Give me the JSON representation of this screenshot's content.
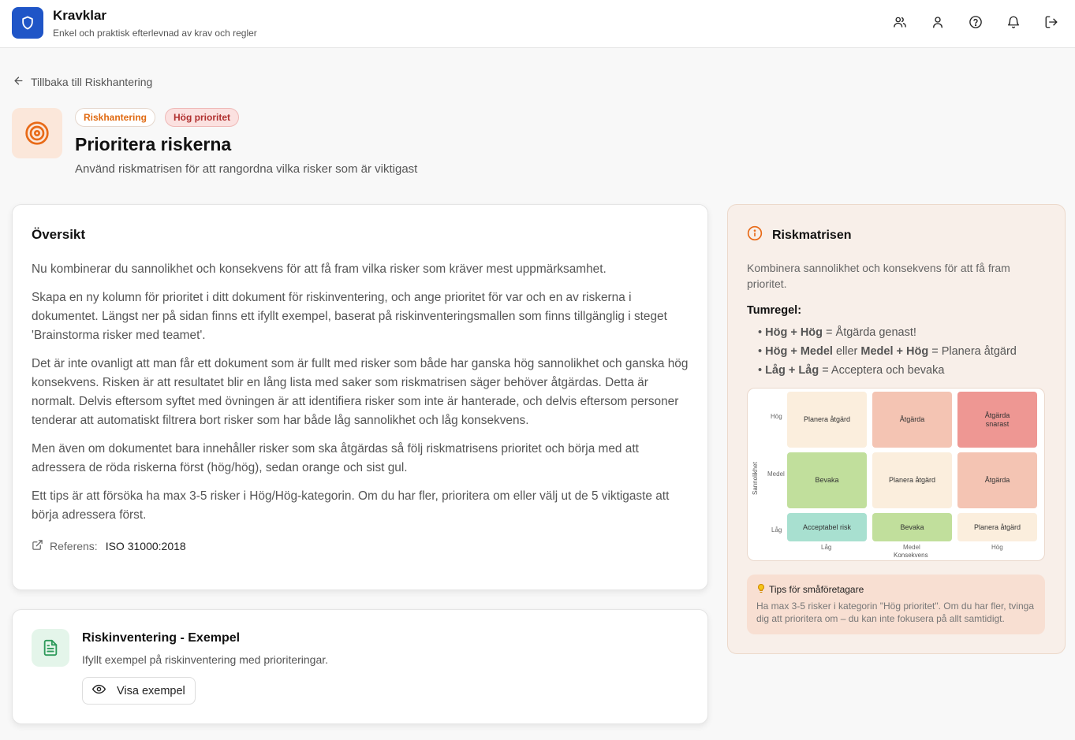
{
  "app": {
    "title": "Kravklar",
    "subtitle": "Enkel och praktisk efterlevnad av krav och regler",
    "accent": "#1f55c7"
  },
  "header_icons": [
    "users-icon",
    "user-icon",
    "help-icon",
    "bell-icon",
    "logout-icon"
  ],
  "back_link": "Tillbaka till Riskhantering",
  "task": {
    "category_badge": "Riskhantering",
    "priority_badge": "Hög prioritet",
    "title": "Prioritera riskerna",
    "subtitle": "Använd riskmatrisen för att rangordna vilka risker som är viktigast"
  },
  "overview": {
    "heading": "Översikt",
    "paragraphs": [
      "Nu kombinerar du sannolikhet och konsekvens för att få fram vilka risker som kräver mest uppmärksamhet.",
      "Skapa en ny kolumn för prioritet i ditt dokument för riskinventering, och ange prioritet för var och en av riskerna i dokumentet. Längst ner på sidan finns ett ifyllt exempel, baserat på riskinventeringsmallen som finns tillgänglig i steget 'Brainstorma risker med teamet'.",
      "Det är inte ovanligt att man får ett dokument som är fullt med risker som både har ganska hög sannolikhet och ganska hög konsekvens. Risken är att resultatet blir en lång lista med saker som riskmatrisen säger behöver åtgärdas. Detta är normalt. Delvis eftersom syftet med övningen är att identifiera risker som inte är hanterade, och delvis eftersom personer tenderar att automatiskt filtrera bort risker som har både låg sannolikhet och låg konsekvens.",
      "Men även om dokumentet bara innehåller risker som ska åtgärdas så följ riskmatrisens prioritet och börja med att adressera de röda riskerna först (hög/hög), sedan orange och sist gul.",
      "Ett tips är att försöka ha max 3-5 risker i Hög/Hög-kategorin. Om du har fler, prioritera om eller välj ut de 5 viktigaste att börja adressera först."
    ],
    "reference_label": "Referens:",
    "reference_value": "ISO 31000:2018"
  },
  "example": {
    "title": "Riskinventering - Exempel",
    "subtitle": "Ifyllt exempel på riskinventering med prioriteringar.",
    "button": "Visa exempel"
  },
  "side": {
    "heading": "Riskmatrisen",
    "description": "Kombinera sannolikhet och konsekvens för att få fram prioritet.",
    "rule_title": "Tumregel:",
    "rules": [
      {
        "bullet": "•",
        "a": "Hög + Hög",
        "mid": "",
        "b": "",
        "rest": " = Åtgärda genast!"
      },
      {
        "bullet": "•",
        "a": "Hög + Medel",
        "mid": " eller ",
        "b": "Medel + Hög",
        "rest": " = Planera åtgärd"
      },
      {
        "bullet": "•",
        "a": "Låg + Låg",
        "mid": "",
        "b": "",
        "rest": " = Acceptera och bevaka"
      }
    ],
    "matrix": {
      "y_axis": "Sannolikhet",
      "x_axis": "Konsekvens",
      "rows": [
        "Hög",
        "Medel",
        "Låg"
      ],
      "cols": [
        "Låg",
        "Medel",
        "Hög"
      ],
      "cells": [
        [
          "Planera åtgärd",
          "Åtgärda",
          "Åtgärda snarast"
        ],
        [
          "Bevaka",
          "Planera åtgärd",
          "Åtgärda"
        ],
        [
          "Acceptabel risk",
          "Bevaka",
          "Planera åtgärd"
        ]
      ],
      "colors": {
        "plan": "#fbeedd",
        "atgarda": "#f4c4b3",
        "snarast": "#ee9793",
        "bevaka": "#c1df9c",
        "acceptabel": "#a8e0d0"
      }
    },
    "tips_title": "Tips för småföretagare",
    "tips_text": "Ha max 3-5 risker i kategorin \"Hög prioritet\". Om du har fler, tvinga dig att prioritera om – du kan inte fokusera på allt samtidigt."
  }
}
